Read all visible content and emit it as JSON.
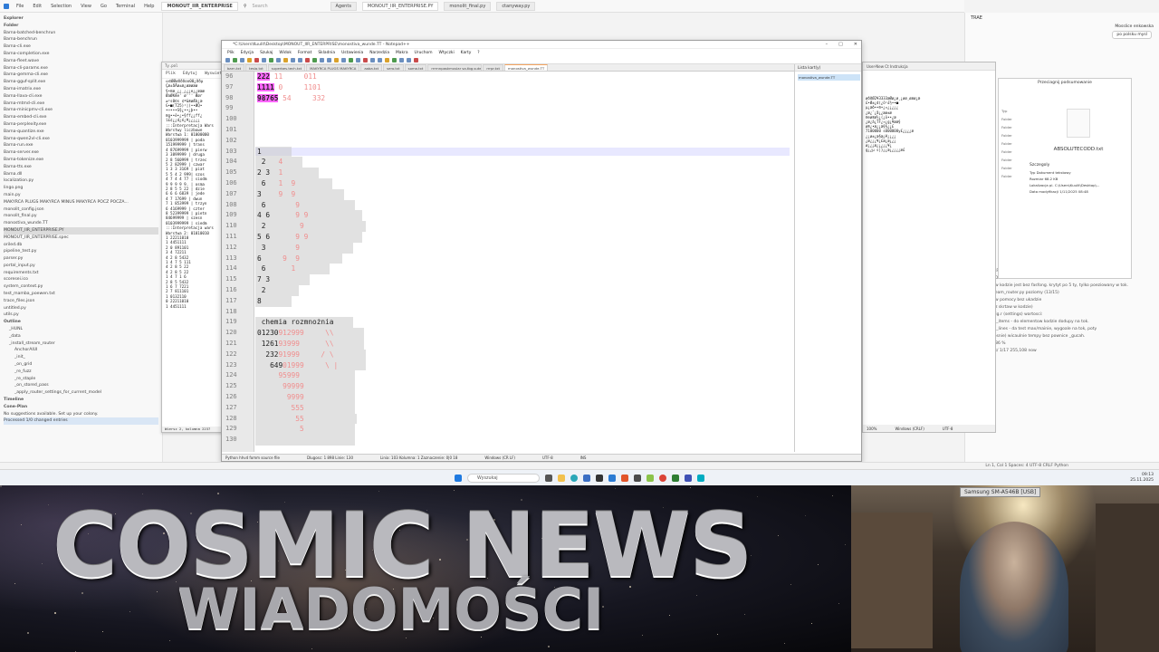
{
  "ide": {
    "menu": [
      "File",
      "Edit",
      "Selection",
      "View",
      "Go",
      "Terminal",
      "Help"
    ],
    "active_tab": "MONOUT_IIR_ENTERPRISE",
    "search_placeholder": "Search",
    "tabs": [
      "Agents",
      "MONOUT_IIR_ENTERPRISE.PY",
      "monolit_final.py",
      "ctanyway.py"
    ],
    "explorer_title": "Explorer",
    "folder_label": "Folder",
    "files": [
      "Barna-batched-benchrun",
      "Barna-benchrun",
      "Barna-cli.exe",
      "Barna-completion.exe",
      "Barna-fleet.wave",
      "Barna-cli-params.exe",
      "Barna-gemma-cli.exe",
      "Barna-gguf-split.exe",
      "Barna-imatrix.exe",
      "Barna-llava-cli.exe",
      "Barna-mtmd-cli.exe",
      "Barna-minicpmv-cli.exe",
      "Barna-embed-cli.exe",
      "Barna-perplexity.exe",
      "Barna-quantize.exe",
      "Barna-qwen2vl-cli.exe",
      "Barna-run.exe",
      "Barna-server.exe",
      "Barna-tokenize.exe",
      "Barna-tts.exe",
      "Barna.dll",
      "localization.py",
      "lingo.png",
      "main.py",
      "MAKYRCA PLUGS MAKYRCA MINUS MAKYRCA POCZ POCZA...",
      "monolit_config.json",
      "monolit_final.py",
      "monostiva_wunde.TT",
      "MONOUT_IIR_ENTERPRISE.PY",
      "MONOUT_IIR_ENTERPRISE.spec",
      "oriled.db",
      "pipeline_test.py",
      "parser.py",
      "portal_input.py",
      "requirements.txt",
      "scoresei.ico",
      "system_context.py",
      "test_mamba_poewen.txt",
      "trace_files.json",
      "untitled.py",
      "utils.py"
    ],
    "outline_title": "Outline",
    "outline_items": [
      "_HUNL",
      "_data",
      "_install_stream_router",
      "AnchorAIUI",
      "_init_",
      "_on_grid",
      "_re_fuzz",
      "_re_staple",
      "_on_stored_pass",
      "_apply_router_settings_for_current_model"
    ],
    "timeline_title": "Timeline",
    "cone_title": "Cone-Plan",
    "status_hint": "No suggestions available. Set up your colony.",
    "processed": "Processed 1/0 changed entries",
    "statusbar_right": "Ln 1, Col 1   Spaces: 4   UTF-8   CRLF   Python"
  },
  "right_panel": {
    "title": "TRAE",
    "user": "Mosslice enkowska",
    "btn_new": "po polsku mysl",
    "texts": [
      "TEST_ENTERPRISE.PY I instrukcja do wyboru, ptoj wy/gdyt",
      "ABSOLUTECODD",
      "cto SE2108 w kodzie jest bez fasfong. krytyt po 5 ty, tylko poeziowany w tok.",
      "test/test_stream_router.py poziomy (13/15)",
      "n_copulitall w pomocy bez ukadzie",
      "Zajemle (bez skrtaw w kodzie)",
      "Odd do config.r (settings) wartosci:",
      "max_ui_max_items - do elementow kodzie dodupy na tok.",
      "max_ui_max_lines - da test max/mainie, wygoale na tok, poty",
      "Musle(psuposnie) wicaulnie tempy bez pownice _gucah.",
      "page/4/255.86 %",
      "with settings/ 1/17 255,108 now"
    ]
  },
  "left_window": {
    "title": "Ty.pol",
    "tabs": [
      "Plik",
      "Edytuj",
      "Wyswietl"
    ],
    "lines": [
      "⛀©ØØøðððoo00¿ððµ",
      "Çæ±åÄø±æ¿øæøæø",
      "§•®æ¸¿¿¸¿¿¿e¿¿æææ",
      "ØaØKÆe' ø''' Øør",
      "≥²s0©s ¢ª&®øÆb¿æ",
      "G•■(T25)¹|(••ØQ•",
      "•☼•••S§¿••¿þ••",
      "®g••ë•¿•§ff¿¿ff¿",
      "î£¢¿¿d¿é¿¥¿¿¿¿¿",
      ":::Interpretacja Wars",
      "Warstwy liczbowe",
      "",
      "Warstwa 1: 01000000",
      "0103999999 | poda",
      "151999999  | trans",
      "4 87699999 | pierw",
      "3 3899999  | druga",
      "2 8 560999 | trzec",
      "5 2 82999  | czwar",
      "1 3 3 3169 | piat",
      "5 5 4 2 999| szos",
      "4 7 4 4 77 | siodm",
      "9 9 9 9 9. | osma",
      "2 8 5 5 22 | dzie",
      "6 6 6 6839 | jede",
      "4 7 17699  | dwun",
      "7 1 853999 | trzyn",
      "6 4169999  | czter",
      "8 52399999 | pietn",
      "84699999   | szesn",
      "0103999999 | siedm",
      ":::Interpretacja wars",
      "Warstwa 2: 01010010",
      "",
      "1 22211010",
      "  1 4451111",
      "2 0 891101",
      "3 4 72211",
      "4 2 8 5432",
      "1 4 7 5 111",
      "4 2 8 5 22",
      "4 2 8 5 22",
      "1 4 7 1 6",
      "2 8 5 5432",
      "1 6 7 7221",
      "2 7 811101",
      "  1 0132110",
      "  0 22211010",
      "  1 4451111"
    ],
    "status": "Wiersz 2, kolumna 2237"
  },
  "notepad": {
    "title": "*C:\\Users\\Kuulit\\Desktop\\MONOUT_IIR_ENTERPRISE\\monostiva_wunde.TT - Notepad++",
    "menu": [
      "Plik",
      "Edycja",
      "Szukaj",
      "Widok",
      "Format",
      "Skladnia",
      "Ustawienia",
      "Narzedzia",
      "Makra",
      "Uruchom",
      "Wtyczki",
      "Karty",
      "?"
    ],
    "tabs": [
      "barn.txt",
      "tesla.txt",
      "superbes.tech.txt",
      "MAKYRCA PLUGS MAKYRCA",
      "aaba.txt",
      "sero.txt",
      "soma.txt",
      "rrrrnnpaskmuslar sa.tbg.sutest.txt",
      "rrrpr.txt",
      "monostiva_wunde.TT"
    ],
    "lines": [
      {
        "n": "96",
        "t": "222",
        "f": " 11     011"
      },
      {
        "n": "97",
        "t": "1111",
        "f": " 0     1101"
      },
      {
        "n": "98",
        "t": "98765",
        "f": " 54     332"
      },
      {
        "n": "99",
        "t": "",
        "f": ""
      },
      {
        "n": "100",
        "t": "",
        "f": ""
      },
      {
        "n": "101",
        "t": "",
        "f": ""
      },
      {
        "n": "102",
        "t": "",
        "f": ""
      },
      {
        "n": "103",
        "t": "1",
        "f": ""
      },
      {
        "n": "104",
        "t": " 2",
        "f": "   4"
      },
      {
        "n": "105",
        "t": "2 3",
        "f": "  1"
      },
      {
        "n": "106",
        "t": " 6",
        "f": "   1  9"
      },
      {
        "n": "107",
        "t": "3",
        "f": "    9  9"
      },
      {
        "n": "108",
        "t": " 6",
        "f": "       9"
      },
      {
        "n": "109",
        "t": "4 6",
        "f": "      9 9"
      },
      {
        "n": "110",
        "t": " 2",
        "f": "        9"
      },
      {
        "n": "111",
        "t": "5 6",
        "f": "      9 9"
      },
      {
        "n": "112",
        "t": " 3",
        "f": "       9"
      },
      {
        "n": "113",
        "t": "6",
        "f": "     9  9"
      },
      {
        "n": "114",
        "t": " 6",
        "f": "      1"
      },
      {
        "n": "115",
        "t": "7 3",
        "f": ""
      },
      {
        "n": "116",
        "t": " 2",
        "f": ""
      },
      {
        "n": "117",
        "t": "8",
        "f": ""
      },
      {
        "n": "118",
        "t": "",
        "f": ""
      },
      {
        "n": "119",
        "t": " chemia rozmnożnia",
        "f": ""
      },
      {
        "n": "120",
        "t": "01230",
        "f": "912999     \\\\"
      },
      {
        "n": "121",
        "t": " 1261",
        "f": "93999      \\\\"
      },
      {
        "n": "122",
        "t": "  232",
        "f": "91999     / \\"
      },
      {
        "n": "123",
        "t": "   649",
        "f": "01999     \\ |"
      },
      {
        "n": "124",
        "t": "",
        "f": "     95999"
      },
      {
        "n": "125",
        "t": "",
        "f": "      99999"
      },
      {
        "n": "126",
        "t": "",
        "f": "       9999"
      },
      {
        "n": "127",
        "t": "",
        "f": "        555"
      },
      {
        "n": "128",
        "t": "",
        "f": "         55"
      },
      {
        "n": "129",
        "t": "",
        "f": "          5"
      },
      {
        "n": "130",
        "t": "",
        "f": ""
      }
    ],
    "doc_list_title": "Lista kart(y)",
    "doc_list_item": "monostiva_wunde.TT",
    "status": [
      "Python hhvd fomm source file",
      "Dlugosc: 1 898   Linie: 130",
      "Linia: 103   Kolumna: 1   Zaznaczenie: 0|0 18",
      "Windows (CR LF)",
      "UTF-8",
      "INS"
    ]
  },
  "right_window": {
    "title": "User-New Ct   Instrukcja",
    "lines": [
      "øððØ2¥3333æØø¿ø¸¿øø¸øæø¿æ",
      "£•Ø±¿d(¿ö¹£½••■",
      "µ¿æð••®•¿¤¿¿¿¿¿",
      "¿æ¿¨¿å¿¿æø±æ",
      "®eø®æ½¿(¿õ••¿æ",
      "¿æ¿â¿TF¿¤¿g¿¥ææ§",
      "ø®¿•æ¿¿æ§§¿¿£",
      "7100000 s000000y£¿¿¿¿æ",
      "¿¿ø±¿æ§æ¿¥¿¿¿¿",
      "¿æ¿¿¿¥¿£æ¿æ¿¿¿",
      "ø¿¿¿æ¿¿¿¿¿¥¿",
      "g¿¿µ s|}¿¿æ¿¿¿¿¿æ£"
    ],
    "status": [
      "100%",
      "Windows (CRLF)",
      "UTF-8"
    ]
  },
  "props_window": {
    "title": "Przeciagnij podsumowanie",
    "file": "ABSOLUTECODD.txt",
    "labels": [
      "Typ",
      "Folder",
      "Folder",
      "Folder",
      "Folder",
      "Folder",
      "Folder",
      "Folder",
      "Folder"
    ],
    "details_title": "Szczegoly",
    "details": [
      "Typ   Dokument tekstowy",
      "Rozmiar   68.2 KB",
      "Lokalizacja pl.   C:\\Users\\Kuulit\\Desktop\\...",
      "Data modyfikacji   1/11/2025 08:48"
    ]
  },
  "taskbar": {
    "search": "Wyszukaj",
    "time": "09:13",
    "date": "25.11.2025"
  },
  "banner": {
    "title": "COSMIC NEWS",
    "subtitle": "WIADOMOŚCI"
  },
  "webcam": {
    "label": "Samsung SM-A546B [USB]"
  }
}
